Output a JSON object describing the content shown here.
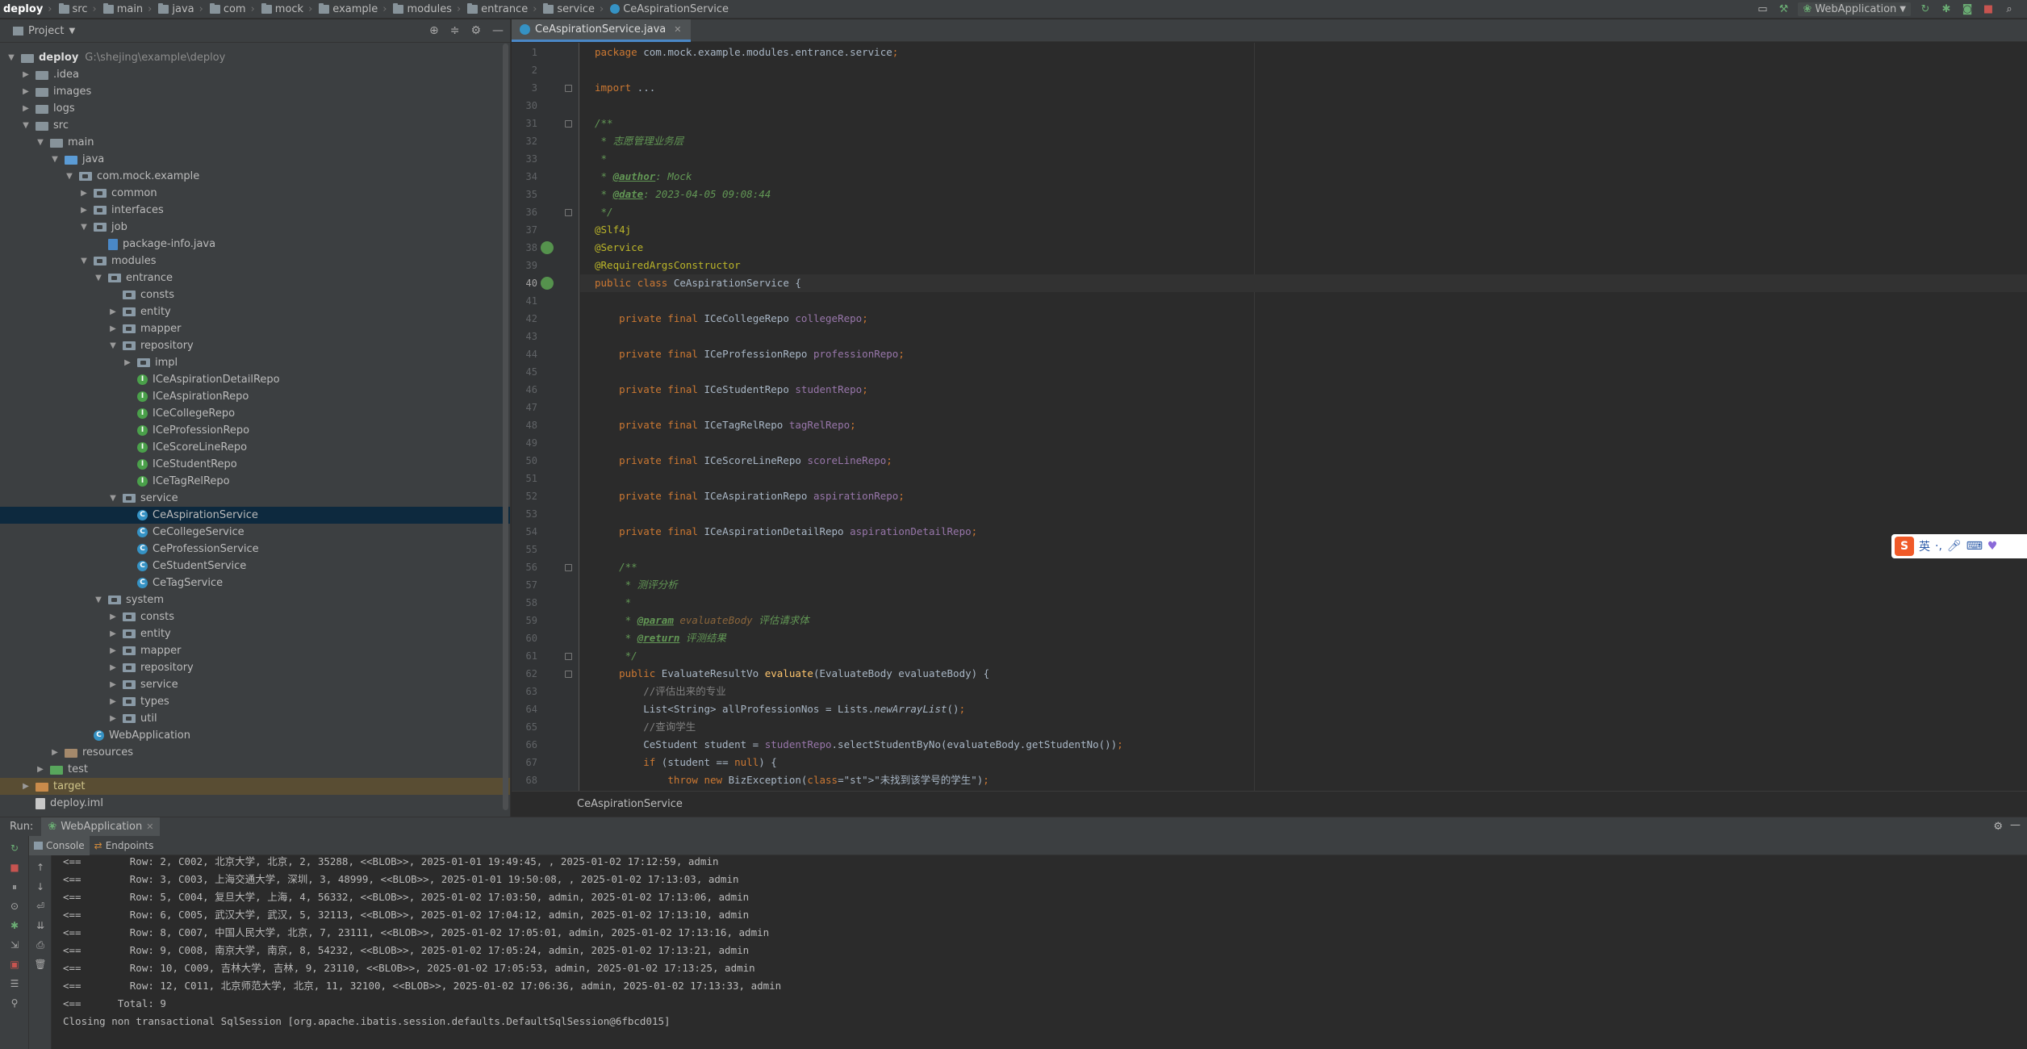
{
  "breadcrumb": {
    "project": "deploy",
    "items": [
      "src",
      "main",
      "java",
      "com",
      "mock",
      "example",
      "modules",
      "entrance",
      "service",
      "CeAspirationService"
    ]
  },
  "toolbar": {
    "run_config": "WebApplication",
    "icons": [
      "hammer-icon",
      "run-icon",
      "debug-icon",
      "coverage-icon",
      "stop-icon",
      "search-icon"
    ]
  },
  "project_panel": {
    "title": "Project",
    "root_name": "deploy",
    "root_path": "G:\\shejing\\example\\deploy",
    "rows": [
      {
        "label": "deploy",
        "depth": 0,
        "icon": "folder",
        "expanded": true
      },
      {
        "label": ".idea",
        "depth": 1,
        "icon": "folder",
        "expanded": false
      },
      {
        "label": "images",
        "depth": 1,
        "icon": "folder",
        "expanded": false
      },
      {
        "label": "logs",
        "depth": 1,
        "icon": "folder",
        "expanded": false
      },
      {
        "label": "src",
        "depth": 1,
        "icon": "folder",
        "expanded": true
      },
      {
        "label": "main",
        "depth": 2,
        "icon": "folder",
        "expanded": true
      },
      {
        "label": "java",
        "depth": 3,
        "icon": "folder-src",
        "expanded": true
      },
      {
        "label": "com.mock.example",
        "depth": 4,
        "icon": "package",
        "expanded": true
      },
      {
        "label": "common",
        "depth": 5,
        "icon": "package",
        "expanded": false
      },
      {
        "label": "interfaces",
        "depth": 5,
        "icon": "package",
        "expanded": false
      },
      {
        "label": "job",
        "depth": 5,
        "icon": "package",
        "expanded": true
      },
      {
        "label": "package-info.java",
        "depth": 6,
        "icon": "java-file",
        "expanded": null
      },
      {
        "label": "modules",
        "depth": 5,
        "icon": "package",
        "expanded": true
      },
      {
        "label": "entrance",
        "depth": 6,
        "icon": "package",
        "expanded": true
      },
      {
        "label": "consts",
        "depth": 7,
        "icon": "package",
        "expanded": null
      },
      {
        "label": "entity",
        "depth": 7,
        "icon": "package",
        "expanded": false
      },
      {
        "label": "mapper",
        "depth": 7,
        "icon": "package",
        "expanded": false
      },
      {
        "label": "repository",
        "depth": 7,
        "icon": "package",
        "expanded": true
      },
      {
        "label": "impl",
        "depth": 8,
        "icon": "package",
        "expanded": false
      },
      {
        "label": "ICeAspirationDetailRepo",
        "depth": 8,
        "icon": "interface",
        "expanded": null
      },
      {
        "label": "ICeAspirationRepo",
        "depth": 8,
        "icon": "interface",
        "expanded": null
      },
      {
        "label": "ICeCollegeRepo",
        "depth": 8,
        "icon": "interface",
        "expanded": null
      },
      {
        "label": "ICeProfessionRepo",
        "depth": 8,
        "icon": "interface",
        "expanded": null
      },
      {
        "label": "ICeScoreLineRepo",
        "depth": 8,
        "icon": "interface",
        "expanded": null
      },
      {
        "label": "ICeStudentRepo",
        "depth": 8,
        "icon": "interface",
        "expanded": null
      },
      {
        "label": "ICeTagRelRepo",
        "depth": 8,
        "icon": "interface",
        "expanded": null
      },
      {
        "label": "service",
        "depth": 7,
        "icon": "package",
        "expanded": true
      },
      {
        "label": "CeAspirationService",
        "depth": 8,
        "icon": "class",
        "expanded": null,
        "selected": true
      },
      {
        "label": "CeCollegeService",
        "depth": 8,
        "icon": "class",
        "expanded": null
      },
      {
        "label": "CeProfessionService",
        "depth": 8,
        "icon": "class",
        "expanded": null
      },
      {
        "label": "CeStudentService",
        "depth": 8,
        "icon": "class",
        "expanded": null
      },
      {
        "label": "CeTagService",
        "depth": 8,
        "icon": "class",
        "expanded": null
      },
      {
        "label": "system",
        "depth": 6,
        "icon": "package",
        "expanded": true
      },
      {
        "label": "consts",
        "depth": 7,
        "icon": "package",
        "expanded": false
      },
      {
        "label": "entity",
        "depth": 7,
        "icon": "package",
        "expanded": false
      },
      {
        "label": "mapper",
        "depth": 7,
        "icon": "package",
        "expanded": false
      },
      {
        "label": "repository",
        "depth": 7,
        "icon": "package",
        "expanded": false
      },
      {
        "label": "service",
        "depth": 7,
        "icon": "package",
        "expanded": false
      },
      {
        "label": "types",
        "depth": 7,
        "icon": "package",
        "expanded": false
      },
      {
        "label": "util",
        "depth": 7,
        "icon": "package",
        "expanded": false
      },
      {
        "label": "WebApplication",
        "depth": 5,
        "icon": "class-spring",
        "expanded": null
      },
      {
        "label": "resources",
        "depth": 3,
        "icon": "folder-res",
        "expanded": false
      },
      {
        "label": "test",
        "depth": 2,
        "icon": "folder-test",
        "expanded": false
      },
      {
        "label": "target",
        "depth": 1,
        "icon": "folder-target",
        "expanded": false,
        "ignored": true
      },
      {
        "label": "deploy.iml",
        "depth": 1,
        "icon": "file",
        "expanded": null
      }
    ]
  },
  "editor": {
    "tab_label": "CeAspirationService.java",
    "status_text": "CeAspirationService",
    "current_line": 40,
    "lines": [
      {
        "n": "1",
        "t": "package com.mock.example.modules.entrance.service;"
      },
      {
        "n": "2",
        "t": ""
      },
      {
        "n": "3",
        "t": "import ..."
      },
      {
        "n": "30",
        "t": ""
      },
      {
        "n": "31",
        "t": "/**"
      },
      {
        "n": "32",
        "t": " * 志愿管理业务层"
      },
      {
        "n": "33",
        "t": " *"
      },
      {
        "n": "34",
        "t": " * @author: Mock"
      },
      {
        "n": "35",
        "t": " * @date: 2023-04-05 09:08:44"
      },
      {
        "n": "36",
        "t": " */"
      },
      {
        "n": "37",
        "t": "@Slf4j"
      },
      {
        "n": "38",
        "t": "@Service"
      },
      {
        "n": "39",
        "t": "@RequiredArgsConstructor"
      },
      {
        "n": "40",
        "t": "public class CeAspirationService {"
      },
      {
        "n": "41",
        "t": ""
      },
      {
        "n": "42",
        "t": "    private final ICeCollegeRepo collegeRepo;"
      },
      {
        "n": "43",
        "t": ""
      },
      {
        "n": "44",
        "t": "    private final ICeProfessionRepo professionRepo;"
      },
      {
        "n": "45",
        "t": ""
      },
      {
        "n": "46",
        "t": "    private final ICeStudentRepo studentRepo;"
      },
      {
        "n": "47",
        "t": ""
      },
      {
        "n": "48",
        "t": "    private final ICeTagRelRepo tagRelRepo;"
      },
      {
        "n": "49",
        "t": ""
      },
      {
        "n": "50",
        "t": "    private final ICeScoreLineRepo scoreLineRepo;"
      },
      {
        "n": "51",
        "t": ""
      },
      {
        "n": "52",
        "t": "    private final ICeAspirationRepo aspirationRepo;"
      },
      {
        "n": "53",
        "t": ""
      },
      {
        "n": "54",
        "t": "    private final ICeAspirationDetailRepo aspirationDetailRepo;"
      },
      {
        "n": "55",
        "t": ""
      },
      {
        "n": "56",
        "t": "    /**"
      },
      {
        "n": "57",
        "t": "     * 测评分析"
      },
      {
        "n": "58",
        "t": "     *"
      },
      {
        "n": "59",
        "t": "     * @param evaluateBody 评估请求体"
      },
      {
        "n": "60",
        "t": "     * @return 评测结果"
      },
      {
        "n": "61",
        "t": "     */"
      },
      {
        "n": "62",
        "t": "    public EvaluateResultVo evaluate(EvaluateBody evaluateBody) {"
      },
      {
        "n": "63",
        "t": "        //评估出来的专业"
      },
      {
        "n": "64",
        "t": "        List<String> allProfessionNos = Lists.newArrayList();"
      },
      {
        "n": "65",
        "t": "        //查询学生"
      },
      {
        "n": "66",
        "t": "        CeStudent student = studentRepo.selectStudentByNo(evaluateBody.getStudentNo());"
      },
      {
        "n": "67",
        "t": "        if (student == null) {"
      },
      {
        "n": "68",
        "t": "            throw new BizException(\"未找到该学号的学生\");"
      }
    ]
  },
  "ime": {
    "label": "英",
    "punct": "·,"
  },
  "run_panel": {
    "title": "Run:",
    "config_tab": "WebApplication",
    "tabs": [
      "Console",
      "Endpoints"
    ],
    "lines": [
      "<==        Row: 2, C002, 北京大学, 北京, 2, 35288, <<BLOB>>, 2025-01-01 19:49:45, , 2025-01-02 17:12:59, admin",
      "<==        Row: 3, C003, 上海交通大学, 深圳, 3, 48999, <<BLOB>>, 2025-01-01 19:50:08, , 2025-01-02 17:13:03, admin",
      "<==        Row: 5, C004, 复旦大学, 上海, 4, 56332, <<BLOB>>, 2025-01-02 17:03:50, admin, 2025-01-02 17:13:06, admin",
      "<==        Row: 6, C005, 武汉大学, 武汉, 5, 32113, <<BLOB>>, 2025-01-02 17:04:12, admin, 2025-01-02 17:13:10, admin",
      "<==        Row: 8, C007, 中国人民大学, 北京, 7, 23111, <<BLOB>>, 2025-01-02 17:05:01, admin, 2025-01-02 17:13:16, admin",
      "<==        Row: 9, C008, 南京大学, 南京, 8, 54232, <<BLOB>>, 2025-01-02 17:05:24, admin, 2025-01-02 17:13:21, admin",
      "<==        Row: 10, C009, 吉林大学, 吉林, 9, 23110, <<BLOB>>, 2025-01-02 17:05:53, admin, 2025-01-02 17:13:25, admin",
      "<==        Row: 12, C011, 北京师范大学, 北京, 11, 32100, <<BLOB>>, 2025-01-02 17:06:36, admin, 2025-01-02 17:13:33, admin",
      "<==      Total: 9",
      "Closing non transactional SqlSession [org.apache.ibatis.session.defaults.DefaultSqlSession@6fbcd015]"
    ]
  }
}
